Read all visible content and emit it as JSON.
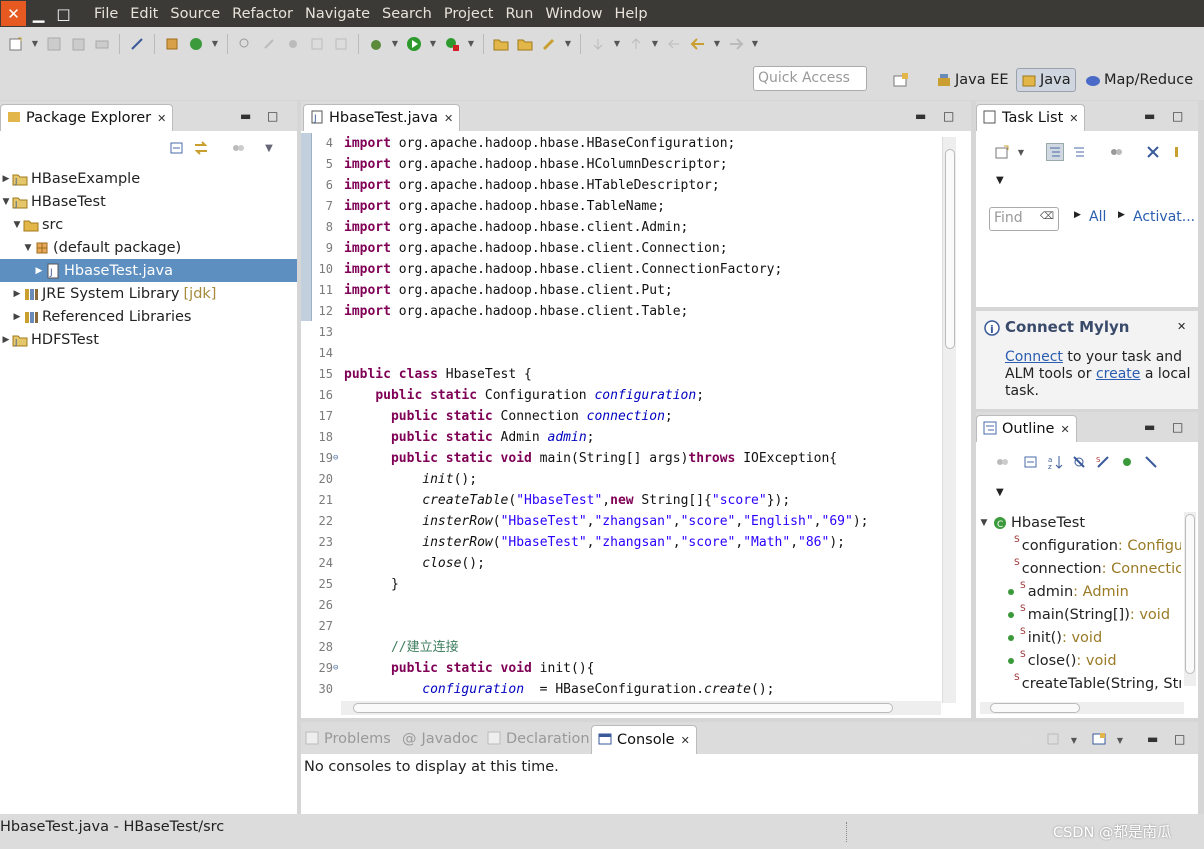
{
  "menubar": {
    "items": [
      "File",
      "Edit",
      "Source",
      "Refactor",
      "Navigate",
      "Search",
      "Project",
      "Run",
      "Window",
      "Help"
    ]
  },
  "toolbar": {
    "quick_access_placeholder": "Quick Access",
    "perspectives": [
      "Java EE",
      "Java",
      "Map/Reduce"
    ]
  },
  "package_explorer": {
    "title": "Package Explorer",
    "tree": [
      {
        "label": "HBaseExample",
        "depth": 0,
        "expanded": false,
        "icon": "project-icon"
      },
      {
        "label": "HBaseTest",
        "depth": 0,
        "expanded": true,
        "icon": "project-icon"
      },
      {
        "label": "src",
        "depth": 1,
        "expanded": true,
        "icon": "source-folder-icon"
      },
      {
        "label": "(default package)",
        "depth": 2,
        "expanded": true,
        "icon": "package-icon"
      },
      {
        "label": "HbaseTest.java",
        "depth": 3,
        "expanded": false,
        "icon": "java-file-icon",
        "selected": true
      },
      {
        "label": "JRE System Library",
        "suffix": "[jdk]",
        "depth": 1,
        "expanded": false,
        "icon": "library-icon"
      },
      {
        "label": "Referenced Libraries",
        "depth": 1,
        "expanded": false,
        "icon": "library-icon"
      },
      {
        "label": "HDFSTest",
        "depth": 0,
        "expanded": false,
        "icon": "project-icon"
      }
    ]
  },
  "editor": {
    "tab": "HbaseTest.java",
    "lines": [
      {
        "n": "4",
        "t": [
          [
            "k",
            "import"
          ],
          [
            "",
            "org.apache.hadoop.hbase.HBaseConfiguration;"
          ]
        ]
      },
      {
        "n": "5",
        "t": [
          [
            "k",
            "import"
          ],
          [
            "",
            "org.apache.hadoop.hbase.HColumnDescriptor;"
          ]
        ]
      },
      {
        "n": "6",
        "t": [
          [
            "k",
            "import"
          ],
          [
            "",
            "org.apache.hadoop.hbase.HTableDescriptor;"
          ]
        ]
      },
      {
        "n": "7",
        "t": [
          [
            "k",
            "import"
          ],
          [
            "",
            "org.apache.hadoop.hbase.TableName;"
          ]
        ]
      },
      {
        "n": "8",
        "t": [
          [
            "k",
            "import"
          ],
          [
            "",
            "org.apache.hadoop.hbase.client.Admin;"
          ]
        ]
      },
      {
        "n": "9",
        "t": [
          [
            "k",
            "import"
          ],
          [
            "",
            "org.apache.hadoop.hbase.client.Connection;"
          ]
        ]
      },
      {
        "n": "10",
        "t": [
          [
            "k",
            "import"
          ],
          [
            "",
            "org.apache.hadoop.hbase.client.ConnectionFactory;"
          ]
        ]
      },
      {
        "n": "11",
        "t": [
          [
            "k",
            "import"
          ],
          [
            "",
            "org.apache.hadoop.hbase.client.Put;"
          ]
        ]
      },
      {
        "n": "12",
        "t": [
          [
            "k",
            "import"
          ],
          [
            "",
            "org.apache.hadoop.hbase.client.Table;"
          ]
        ]
      },
      {
        "n": "13",
        "t": []
      },
      {
        "n": "14",
        "t": []
      },
      {
        "n": "15",
        "t": [
          [
            "k",
            "public class"
          ],
          [
            "",
            " HbaseTest {"
          ]
        ]
      },
      {
        "n": "16",
        "t": [
          [
            "",
            "    "
          ],
          [
            "k",
            "public static"
          ],
          [
            "",
            " Configuration "
          ],
          [
            "f",
            "configuration"
          ],
          [
            "",
            ";"
          ]
        ]
      },
      {
        "n": "17",
        "t": [
          [
            "",
            "      "
          ],
          [
            "k",
            "public static"
          ],
          [
            "",
            " Connection "
          ],
          [
            "f",
            "connection"
          ],
          [
            "",
            ";"
          ]
        ]
      },
      {
        "n": "18",
        "t": [
          [
            "",
            "      "
          ],
          [
            "k",
            "public static"
          ],
          [
            "",
            " Admin "
          ],
          [
            "f",
            "admin"
          ],
          [
            "",
            ";"
          ]
        ]
      },
      {
        "n": "19",
        "fold": true,
        "t": [
          [
            "",
            "      "
          ],
          [
            "k",
            "public static void"
          ],
          [
            "",
            " main(String[] "
          ],
          [
            "",
            "args"
          ],
          [
            "",
            ")"
          ],
          [
            "k",
            "throws"
          ],
          [
            "",
            " IOException{"
          ]
        ]
      },
      {
        "n": "20",
        "t": [
          [
            "",
            "          "
          ],
          [
            "i",
            "init"
          ],
          [
            "",
            "();"
          ]
        ]
      },
      {
        "n": "21",
        "t": [
          [
            "",
            "          "
          ],
          [
            "i",
            "createTable"
          ],
          [
            "",
            "("
          ],
          [
            "s",
            "\"HbaseTest\""
          ],
          [
            "",
            ","
          ],
          [
            "k",
            "new"
          ],
          [
            "",
            " String[]{"
          ],
          [
            "s",
            "\"score\""
          ],
          [
            "",
            "});"
          ]
        ]
      },
      {
        "n": "22",
        "t": [
          [
            "",
            "          "
          ],
          [
            "i",
            "insterRow"
          ],
          [
            "",
            "("
          ],
          [
            "s",
            "\"HbaseTest\""
          ],
          [
            "",
            ","
          ],
          [
            "s",
            "\"zhangsan\""
          ],
          [
            "",
            ","
          ],
          [
            "s",
            "\"score\""
          ],
          [
            "",
            ","
          ],
          [
            "s",
            "\"English\""
          ],
          [
            "",
            ","
          ],
          [
            "s",
            "\"69\""
          ],
          [
            "",
            ");"
          ]
        ]
      },
      {
        "n": "23",
        "t": [
          [
            "",
            "          "
          ],
          [
            "i",
            "insterRow"
          ],
          [
            "",
            "("
          ],
          [
            "s",
            "\"HbaseTest\""
          ],
          [
            "",
            ","
          ],
          [
            "s",
            "\"zhangsan\""
          ],
          [
            "",
            ","
          ],
          [
            "s",
            "\"score\""
          ],
          [
            "",
            ","
          ],
          [
            "s",
            "\"Math\""
          ],
          [
            "",
            ","
          ],
          [
            "s",
            "\"86\""
          ],
          [
            "",
            ");"
          ]
        ]
      },
      {
        "n": "24",
        "t": [
          [
            "",
            "          "
          ],
          [
            "i",
            "close"
          ],
          [
            "",
            "();"
          ]
        ]
      },
      {
        "n": "25",
        "t": [
          [
            "",
            "      }"
          ]
        ]
      },
      {
        "n": "26",
        "t": []
      },
      {
        "n": "27",
        "t": []
      },
      {
        "n": "28",
        "t": [
          [
            "",
            "      "
          ],
          [
            "cm",
            "//建立连接"
          ]
        ]
      },
      {
        "n": "29",
        "fold": true,
        "t": [
          [
            "",
            "      "
          ],
          [
            "k",
            "public static void"
          ],
          [
            "",
            " init(){"
          ]
        ]
      },
      {
        "n": "30",
        "t": [
          [
            "",
            "          "
          ],
          [
            "f",
            "configuration"
          ],
          [
            "",
            "  = HBaseConfiguration."
          ],
          [
            "i",
            "create"
          ],
          [
            "",
            "();"
          ]
        ]
      }
    ]
  },
  "task_list": {
    "title": "Task List",
    "find_placeholder": "Find",
    "all_label": "All",
    "activate_label": "Activat..."
  },
  "mylyn": {
    "title": "Connect Mylyn",
    "connect_link": "Connect",
    "text1": " to your task and ALM tools or ",
    "create_link": "create",
    "text2": " a local task."
  },
  "outline": {
    "title": "Outline",
    "root": "HbaseTest",
    "members": [
      {
        "name": "configuration",
        "type": " : Configu"
      },
      {
        "name": "connection",
        "type": " : Connectic"
      },
      {
        "name": "admin",
        "type": " : Admin"
      },
      {
        "name": "main(String[])",
        "type": " : void"
      },
      {
        "name": "init()",
        "type": " : void"
      },
      {
        "name": "close()",
        "type": " : void"
      },
      {
        "name": "createTable(String, Str",
        "type": ""
      }
    ]
  },
  "console": {
    "tabs": [
      "Problems",
      "Javadoc",
      "Declaration",
      "Console"
    ],
    "active_tab": "Console",
    "message": "No consoles to display at this time."
  },
  "status": {
    "path": "HbaseTest.java - HBaseTest/src",
    "watermark": "CSDN @都是南瓜"
  }
}
